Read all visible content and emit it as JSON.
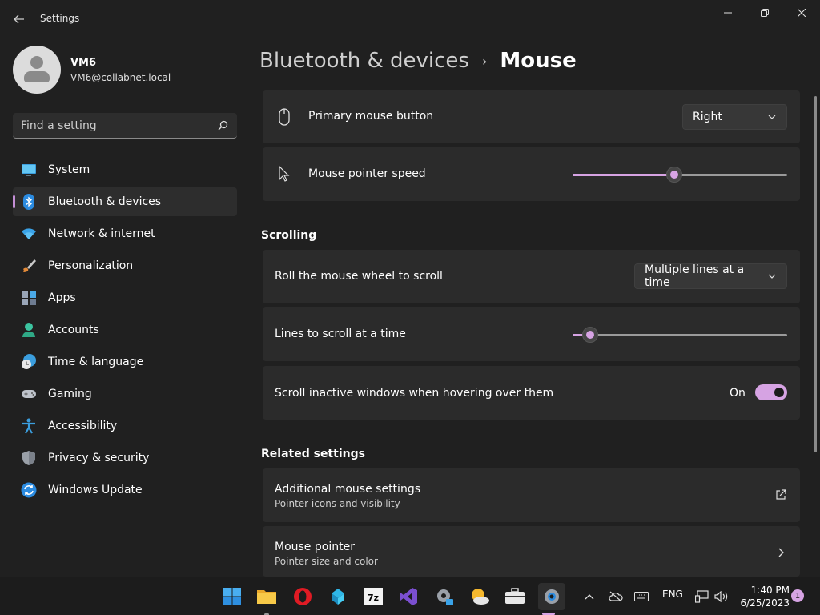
{
  "window": {
    "title": "Settings",
    "back_icon": "arrow-left-icon",
    "minimize_icon": "minimize-icon",
    "maximize_icon": "restore-icon",
    "close_icon": "close-icon"
  },
  "profile": {
    "name": "VM6",
    "email": "VM6@collabnet.local"
  },
  "search": {
    "placeholder": "Find a setting",
    "icon": "search-icon"
  },
  "sidebar": {
    "items": [
      {
        "label": "System",
        "icon": "system-monitor-icon",
        "active": false
      },
      {
        "label": "Bluetooth & devices",
        "icon": "bluetooth-icon",
        "active": true
      },
      {
        "label": "Network & internet",
        "icon": "wifi-icon",
        "active": false
      },
      {
        "label": "Personalization",
        "icon": "paintbrush-icon",
        "active": false
      },
      {
        "label": "Apps",
        "icon": "apps-icon",
        "active": false
      },
      {
        "label": "Accounts",
        "icon": "person-icon",
        "active": false
      },
      {
        "label": "Time & language",
        "icon": "globe-clock-icon",
        "active": false
      },
      {
        "label": "Gaming",
        "icon": "gamepad-icon",
        "active": false
      },
      {
        "label": "Accessibility",
        "icon": "accessibility-icon",
        "active": false
      },
      {
        "label": "Privacy & security",
        "icon": "shield-icon",
        "active": false
      },
      {
        "label": "Windows Update",
        "icon": "sync-icon",
        "active": false
      }
    ]
  },
  "breadcrumb": {
    "parent": "Bluetooth & devices",
    "separator": "›",
    "current": "Mouse"
  },
  "settings": {
    "primary_button": {
      "label": "Primary mouse button",
      "value": "Right",
      "icon": "mouse-icon"
    },
    "pointer_speed": {
      "label": "Mouse pointer speed",
      "value_fraction": 0.47,
      "icon": "pointer-icon"
    },
    "scrolling_title": "Scrolling",
    "roll_wheel": {
      "label": "Roll the mouse wheel to scroll",
      "value": "Multiple lines at a time"
    },
    "lines_to_scroll": {
      "label": "Lines to scroll at a time",
      "value_fraction": 0.05
    },
    "scroll_inactive": {
      "label": "Scroll inactive windows when hovering over them",
      "state": "On",
      "on": true
    },
    "related_title": "Related settings",
    "additional_mouse": {
      "label": "Additional mouse settings",
      "sub": "Pointer icons and visibility",
      "icon": "external-link-icon"
    },
    "mouse_pointer": {
      "label": "Mouse pointer",
      "sub": "Pointer size and color",
      "icon": "chevron-right-icon"
    }
  },
  "taskbar": {
    "apps": [
      "start-icon",
      "file-explorer-icon",
      "opera-icon",
      "app-blue-icon",
      "7zip-icon",
      "visual-studio-icon",
      "settings-gear-icon",
      "weather-icon",
      "toolbox-icon",
      "settings-active-icon"
    ],
    "tray_language": "ENG",
    "time": "1:40 PM",
    "date": "6/25/2023",
    "notification_count": "1"
  },
  "colors": {
    "accent": "#d6a3e3",
    "background": "#202020",
    "card": "#2b2b2b"
  }
}
